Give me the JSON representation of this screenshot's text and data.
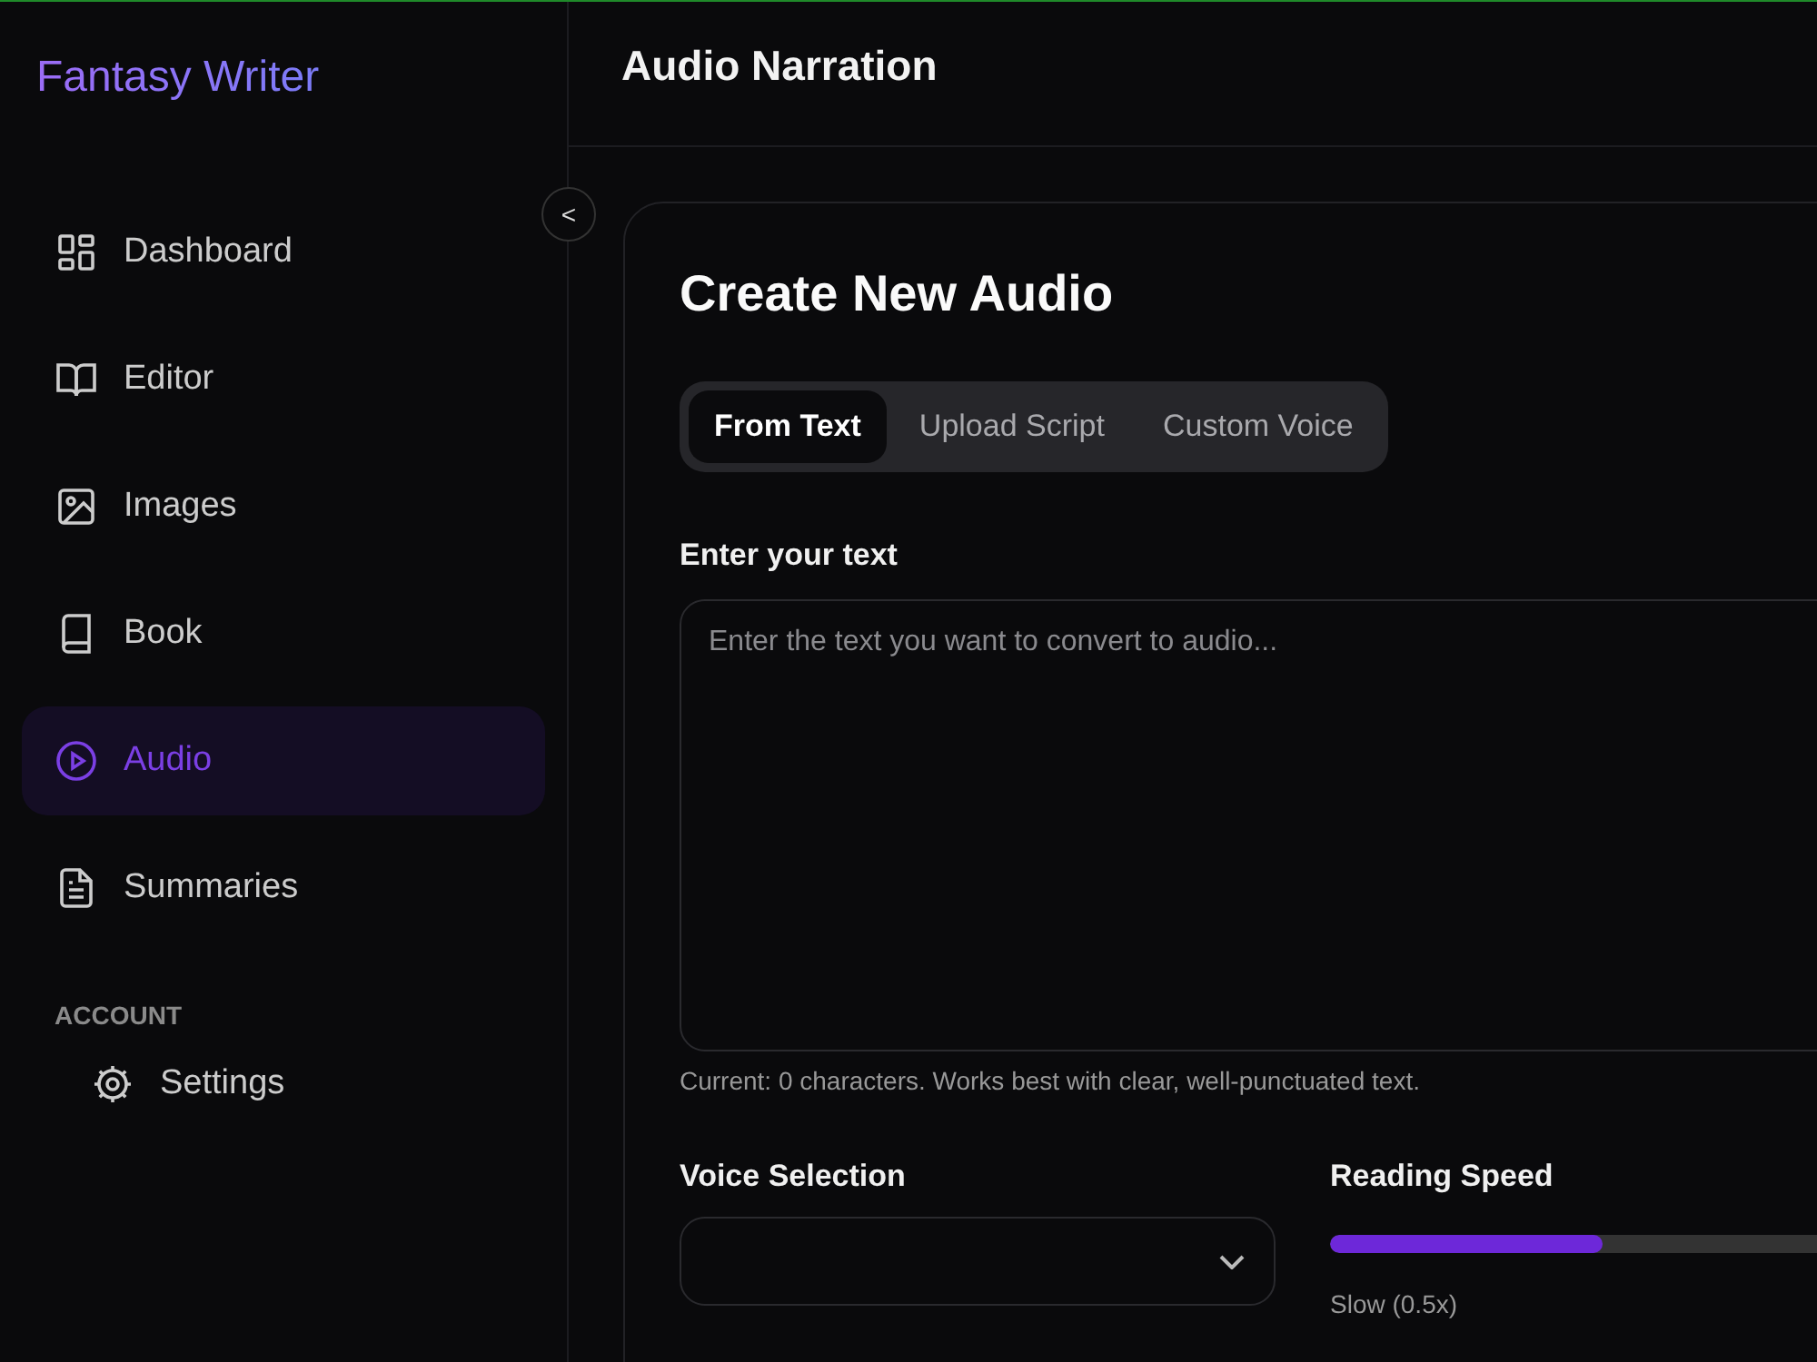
{
  "sidebar": {
    "brand": "Fantasy Writer",
    "items": [
      {
        "label": "Dashboard",
        "selected": false
      },
      {
        "label": "Editor",
        "selected": false
      },
      {
        "label": "Images",
        "selected": false
      },
      {
        "label": "Book",
        "selected": false
      },
      {
        "label": "Audio",
        "selected": true
      },
      {
        "label": "Summaries",
        "selected": false
      }
    ],
    "section": "ACCOUNT",
    "account_items": [
      {
        "label": "Settings"
      }
    ],
    "collapse": "<"
  },
  "header": {
    "title": "Audio Narration"
  },
  "card": {
    "title": "Create New Audio",
    "tabs": [
      {
        "label": "From Text",
        "selected": true
      },
      {
        "label": "Upload Script",
        "selected": false
      },
      {
        "label": "Custom Voice",
        "selected": false
      }
    ],
    "text_label": "Enter your text",
    "text_placeholder": "Enter the text you want to convert to audio...",
    "hint": "Current: 0 characters. Works best with clear, well-punctuated text.",
    "voice_label": "Voice Selection",
    "speed_label": "Reading Speed",
    "speed": {
      "level": 0.5
    },
    "speed_min": "Slow (0.5x)"
  }
}
